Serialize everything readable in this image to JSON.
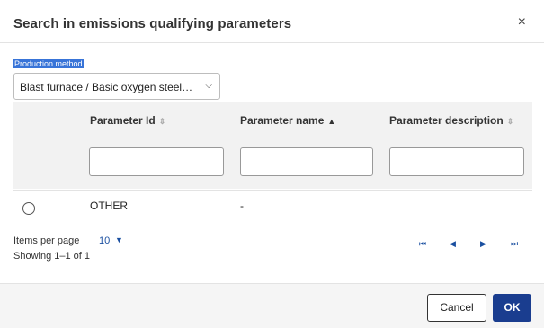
{
  "dialog": {
    "title": "Search in emissions qualifying parameters",
    "close_icon": "close-icon",
    "close_glyph": "×"
  },
  "filter": {
    "label": "Production method",
    "selected": "Blast furnace / Basic oxygen steel…",
    "chevron_glyph": "⌵"
  },
  "table": {
    "columns": [
      {
        "label": "Parameter Id",
        "sort": "⇕"
      },
      {
        "label": "Parameter name",
        "sort": "▲"
      },
      {
        "label": "Parameter description",
        "sort": "⇕"
      }
    ],
    "rows": [
      {
        "id": "OTHER",
        "name": "-",
        "description": ""
      }
    ]
  },
  "pagination": {
    "items_per_page_label": "Items per page",
    "items_per_page_value": "10",
    "caret_glyph": "▼",
    "showing": "Showing 1–1 of 1",
    "first_glyph": "⏮",
    "prev_glyph": "◀",
    "next_glyph": "▶",
    "last_glyph": "⏭"
  },
  "footer": {
    "cancel_label": "Cancel",
    "ok_label": "OK"
  },
  "colors": {
    "accent": "#1a3d8f",
    "link": "#1a4fa0"
  }
}
